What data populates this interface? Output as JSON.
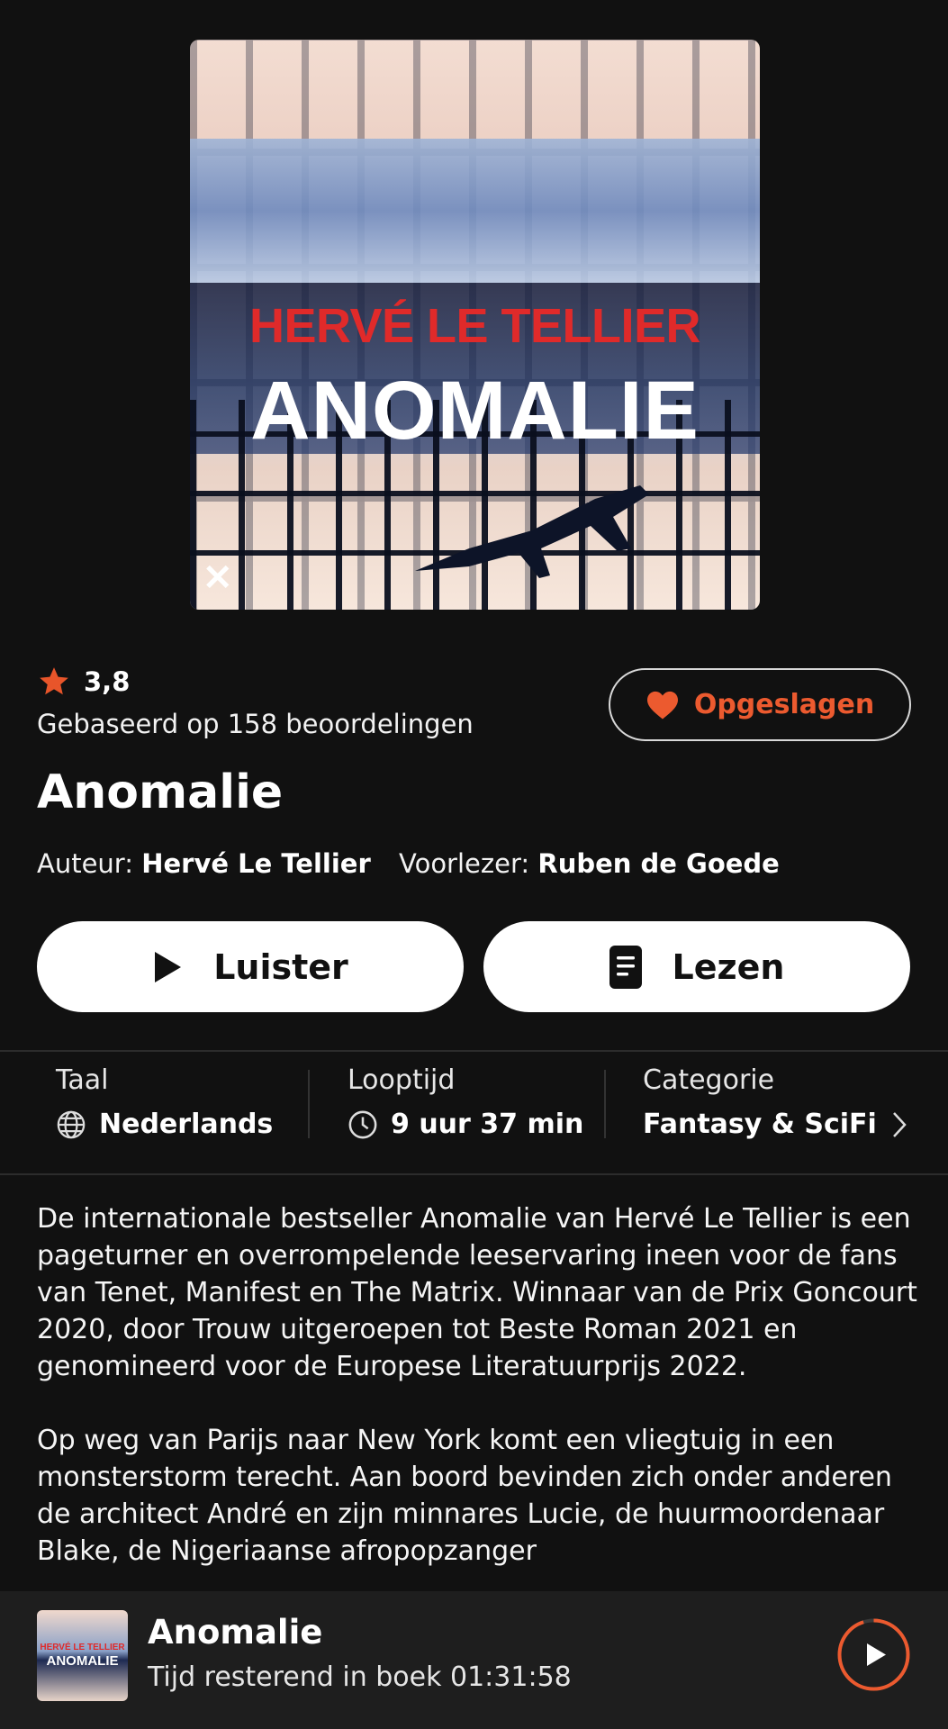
{
  "cover": {
    "author": "HERVÉ LE TELLIER",
    "title": "ANOMALIE"
  },
  "rating": {
    "value": "3,8",
    "basis": "Gebaseerd op 158 beoordelingen",
    "icon": "star-icon",
    "color": "#e8552a"
  },
  "save_button": {
    "label": "Opgeslagen",
    "icon": "heart-icon",
    "color": "#ec5a2f"
  },
  "book": {
    "title": "Anomalie",
    "author_label": "Auteur:",
    "author": "Hervé Le Tellier",
    "narrator_label": "Voorlezer:",
    "narrator": "Ruben de Goede"
  },
  "actions": {
    "listen_label": "Luister",
    "read_label": "Lezen"
  },
  "meta": {
    "language_label": "Taal",
    "language_value": "Nederlands",
    "duration_label": "Looptijd",
    "duration_value": "9 uur 37 min",
    "category_label": "Categorie",
    "category_value": "Fantasy & SciFi"
  },
  "description": {
    "p1": "De internationale bestseller Anomalie van Hervé Le Tellier is een pageturner en overrompelende leeservaring ineen voor de fans van Tenet, Manifest en The Matrix. Winnaar van de Prix Goncourt 2020, door Trouw uitgeroepen tot Beste Roman 2021 en genomineerd voor de Europese Literatuurprijs 2022.",
    "p2": "Op weg van Parijs naar New York komt een vliegtuig in een monsterstorm terecht. Aan boord bevinden zich onder anderen de architect André en zijn minnares Lucie, de huurmoordenaar Blake, de Nigeriaanse afropopzanger"
  },
  "mini_player": {
    "title": "Anomalie",
    "subtitle": "Tijd resterend in boek 01:31:58",
    "thumb_author": "HERVÉ LE TELLIER",
    "thumb_title": "ANOMALIE",
    "progress_fraction": 0.05
  }
}
